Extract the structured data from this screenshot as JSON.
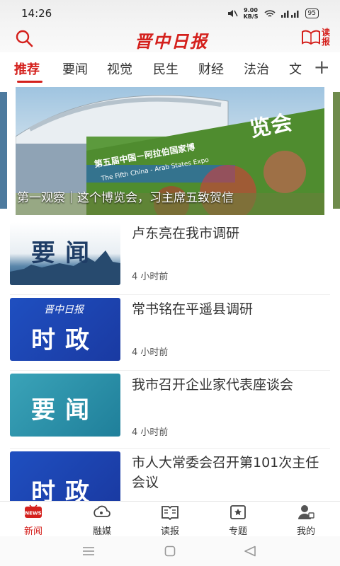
{
  "status": {
    "time": "14:26",
    "net_speed_value": "9.00",
    "net_speed_unit": "KB/S",
    "battery": "95"
  },
  "header": {
    "logo": "晋中日报",
    "reader_label": "读报"
  },
  "tabs": [
    {
      "label": "推荐"
    },
    {
      "label": "要闻"
    },
    {
      "label": "视觉"
    },
    {
      "label": "民生"
    },
    {
      "label": "财经"
    },
    {
      "label": "法治"
    },
    {
      "label": "文"
    }
  ],
  "banner": {
    "caption": "第一观察｜这个博览会，习主席五致贺信",
    "sign_main": "览会",
    "sign_cn": "第五届中国－阿拉伯国家博",
    "sign_en": "The Fifth China - Arab States Expo"
  },
  "news": [
    {
      "title": "卢东亮在我市调研",
      "time": "4 小时前",
      "thumb_text": "要闻",
      "thumb_style": "photo"
    },
    {
      "title": "常书铭在平遥县调研",
      "time": "4 小时前",
      "thumb_text": "时政",
      "thumb_brand": "晋中日报",
      "thumb_style": "blue"
    },
    {
      "title": "我市召开企业家代表座谈会",
      "time": "4 小时前",
      "thumb_text": "要闻",
      "thumb_style": "teal"
    },
    {
      "title": "市人大常委会召开第101次主任会议",
      "time": "",
      "thumb_text": "时政",
      "thumb_style": "blue"
    }
  ],
  "bottom_nav": [
    {
      "label": "新闻",
      "icon": "news-icon",
      "badge": "NEWS"
    },
    {
      "label": "融媒",
      "icon": "media-icon"
    },
    {
      "label": "读报",
      "icon": "newspaper-icon"
    },
    {
      "label": "专题",
      "icon": "topic-icon"
    },
    {
      "label": "我的",
      "icon": "user-icon"
    }
  ],
  "colors": {
    "accent": "#d4201c"
  }
}
